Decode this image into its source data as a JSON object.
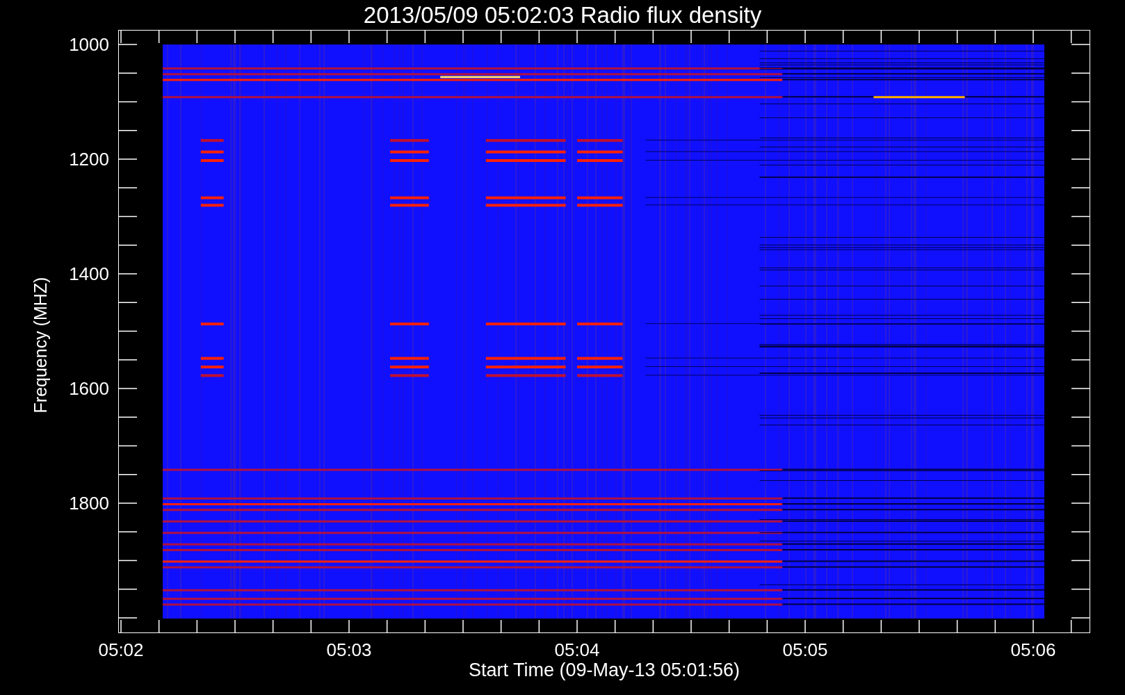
{
  "title": "2013/05/09 05:02:03 Radio flux density",
  "y_axis": {
    "label": "Frequency (MHZ)",
    "ticks": [
      "1000",
      "1200",
      "1400",
      "1600",
      "1800"
    ]
  },
  "x_axis": {
    "label": "Start Time (09-May-13 05:01:56)",
    "ticks": [
      "05:02",
      "05:03",
      "05:04",
      "05:05",
      "05:06"
    ]
  }
}
